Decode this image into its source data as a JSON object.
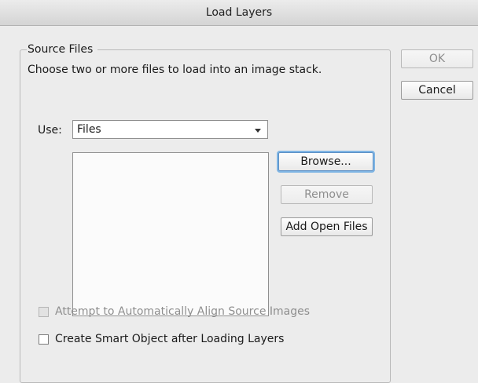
{
  "window": {
    "title": "Load Layers"
  },
  "source_files": {
    "legend": "Source Files",
    "description": "Choose two or more files to load into an image stack.",
    "use_label": "Use:",
    "use_value": "Files",
    "files": []
  },
  "buttons": {
    "ok": "OK",
    "cancel": "Cancel",
    "browse": "Browse...",
    "remove": "Remove",
    "add_open_files": "Add Open Files"
  },
  "options": {
    "auto_align_label": "Attempt to Automatically Align Source Images",
    "auto_align_checked": false,
    "auto_align_enabled": false,
    "smart_object_label": "Create Smart Object after Loading Layers",
    "smart_object_checked": false,
    "smart_object_enabled": true
  },
  "colors": {
    "dialog_bg": "#ececec",
    "focus_ring": "#7fb5e4"
  },
  "icons": {
    "dropdown": "chevron-down-icon"
  }
}
